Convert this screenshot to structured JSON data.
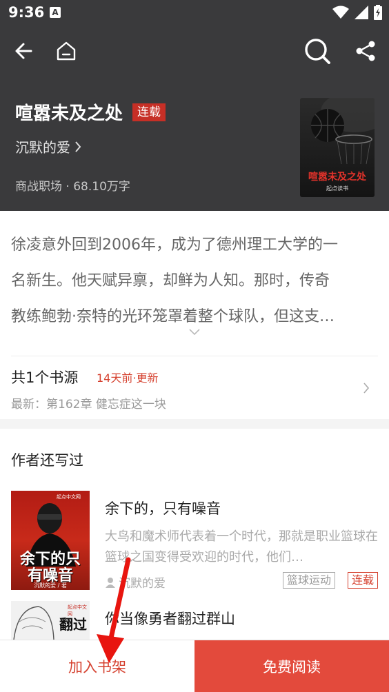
{
  "status_bar": {
    "time": "9:36",
    "app_icon_letter": "A"
  },
  "nav": {
    "back_icon": "back-arrow-icon",
    "home_icon": "home-icon",
    "search_icon": "search-icon",
    "share_icon": "share-icon"
  },
  "book": {
    "title": "喧嚣未及之处",
    "status_badge": "连载",
    "author": "沉默的爱",
    "meta": "商战职场 · 68.10万字",
    "cover_title": "喧嚣未及之处",
    "cover_publisher": "起点读书"
  },
  "synopsis": [
    "徐凌意外回到2006年，成为了德州理工大学的一",
    "名新生。他天赋异禀，却鲜为人知。那时，传奇",
    "教练鲍勃·奈特的光环笼罩着整个球队，但这支…"
  ],
  "source": {
    "count_label": "共1个书源",
    "updated": "14天前·更新",
    "latest": "最新：第162章 健忘症这一块"
  },
  "other_works": {
    "title": "作者还写过",
    "items": [
      {
        "name": "余下的，只有噪音",
        "desc": "大鸟和魔术师代表着一个时代，那就是职业篮球在篮球之国变得受欢迎的时代，他们…",
        "author": "沉默的爱",
        "tag_genre": "篮球运动",
        "tag_status": "连载",
        "cover_title": "余下的只有噪音",
        "cover_pub": "起点中文网",
        "cover_author": "沉默的爱 / 著"
      },
      {
        "name": "你当像勇者翻过群山",
        "cover_title": "翻过",
        "cover_pub": "起点中文网"
      }
    ]
  },
  "bottom": {
    "add_shelf": "加入书架",
    "read_free": "免费阅读"
  },
  "colors": {
    "accent": "#e34a3c",
    "header_bg": "#3a3a3c",
    "badge": "#c62f26"
  }
}
